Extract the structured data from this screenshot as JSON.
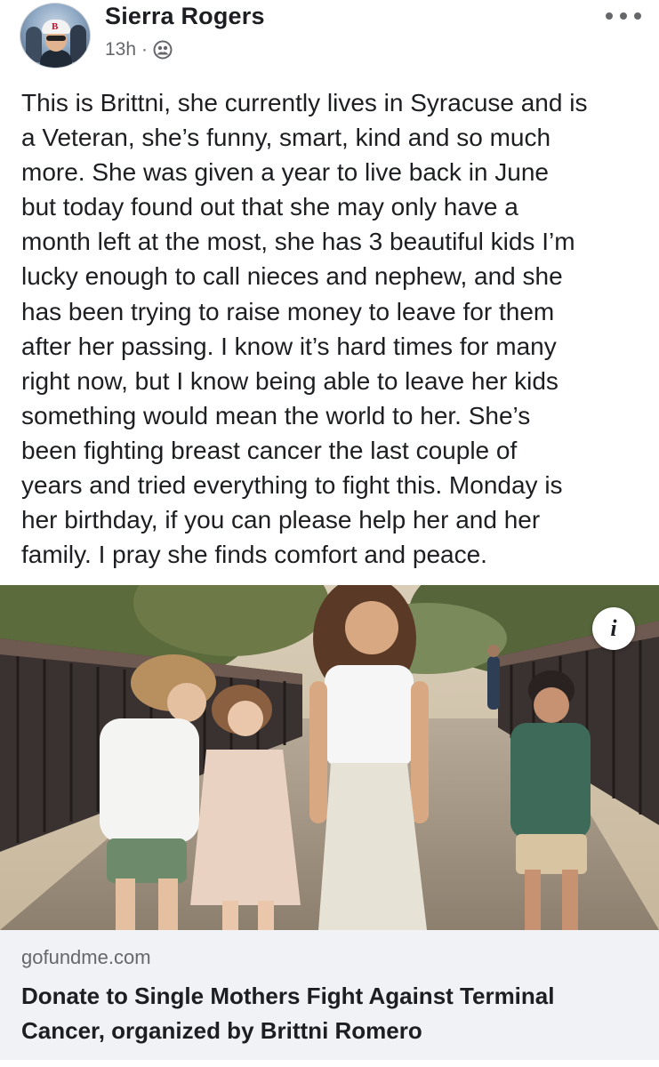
{
  "post": {
    "author": "Sierra Rogers",
    "time": "13h",
    "separator": "·",
    "audience_icon": "friends-icon",
    "more_icon": "more-options-icon",
    "text_lines": [
      "This is Brittni, she currently lives in Syracuse and is",
      "a Veteran, she’s funny, smart, kind and so much",
      "more. She was given a year to live back in June",
      "but today found out that she may only have a",
      "month left at the most, she has 3 beautiful kids I’m",
      "lucky enough to call nieces and nephew, and she",
      "has been trying to raise money to leave for them",
      "after her passing. I know it’s hard times for many",
      "right now, but I know being able to leave her kids",
      "something would mean the world to her. She’s",
      "been fighting breast cancer the last couple of",
      "years and tried everything to fight this. Monday is",
      "her birthday, if you can please help her and her",
      "family. I pray she finds comfort and peace."
    ]
  },
  "link_card": {
    "info_icon": "info-icon",
    "info_glyph": "i",
    "domain": "gofundme.com",
    "title_lines": [
      "Donate to Single Mothers Fight Against Terminal",
      "Cancer, organized by Brittni Romero"
    ]
  },
  "colors": {
    "text_primary": "#1c1e21",
    "text_secondary": "#65676b",
    "card_footer_bg": "#f0f2f5"
  }
}
